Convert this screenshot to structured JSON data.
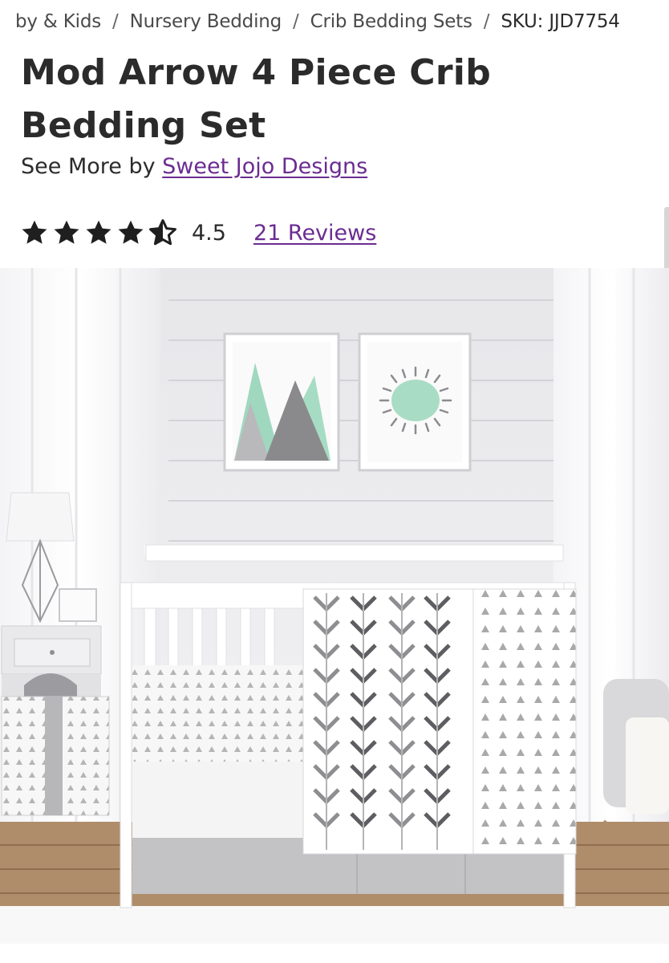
{
  "breadcrumb": {
    "items": [
      "by & Kids",
      "Nursery Bedding",
      "Crib Bedding Sets"
    ],
    "separator": "/",
    "sku": "SKU: JJD7754"
  },
  "product": {
    "title_line1": "Mod Arrow 4 Piece Crib",
    "title_line2": "Bedding Set",
    "see_more_prefix": "See More by",
    "brand": "Sweet Jojo Designs"
  },
  "rating": {
    "value": "4.5",
    "stars_filled": 4.5,
    "stars_total": 5,
    "reviews_label": "21 Reviews"
  },
  "colors": {
    "link": "#6b2c91",
    "text": "#2b2b2b",
    "star": "#1f1f1f"
  },
  "icons": {
    "star_full": "star-icon",
    "star_half": "half-star-icon"
  }
}
